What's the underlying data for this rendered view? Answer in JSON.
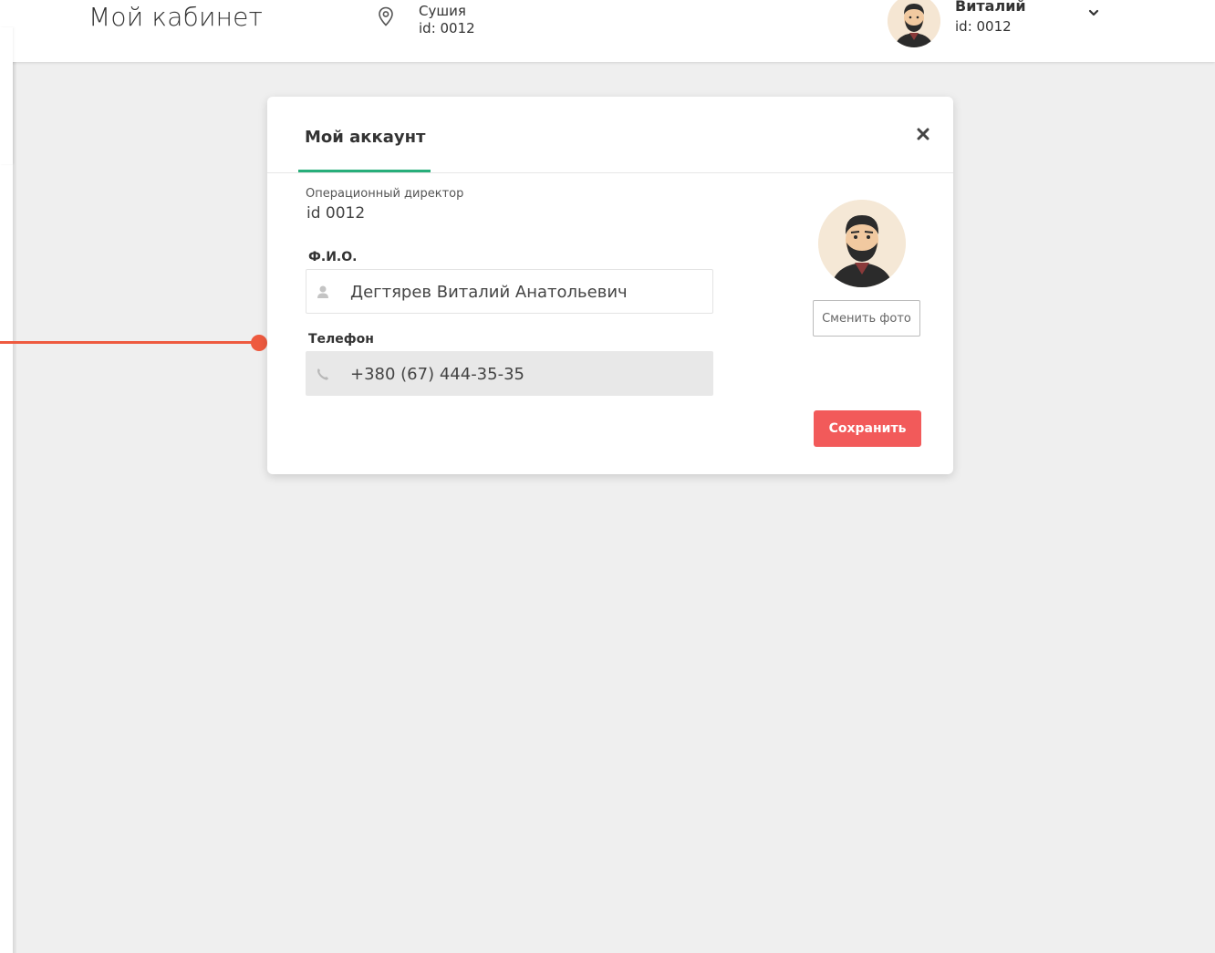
{
  "header": {
    "title": "Мой кабинет",
    "location": {
      "name": "Сушия",
      "id": "id: 0012",
      "icon": "location-pin-icon"
    },
    "user": {
      "name": "Виталий",
      "id": "id: 0012",
      "avatar": "user-avatar-icon",
      "menu_icon": "chevron-down-icon"
    }
  },
  "modal": {
    "title": "Мой аккаунт",
    "close_icon": "close-icon",
    "role": "Операционный директор",
    "role_id": "id 0012",
    "fio": {
      "label": "Ф.И.О.",
      "value": "Дегтярев Виталий Анатольевич",
      "icon": "user-icon"
    },
    "phone": {
      "label": "Телефон",
      "value": "+380 (67) 444-35-35",
      "icon": "phone-icon"
    },
    "change_photo_label": "Сменить фото",
    "save_label": "Сохранить"
  },
  "colors": {
    "accent_green": "#27ae7a",
    "save_red": "#f25a5a",
    "connector": "#ee5a3f",
    "background": "#efefef"
  }
}
